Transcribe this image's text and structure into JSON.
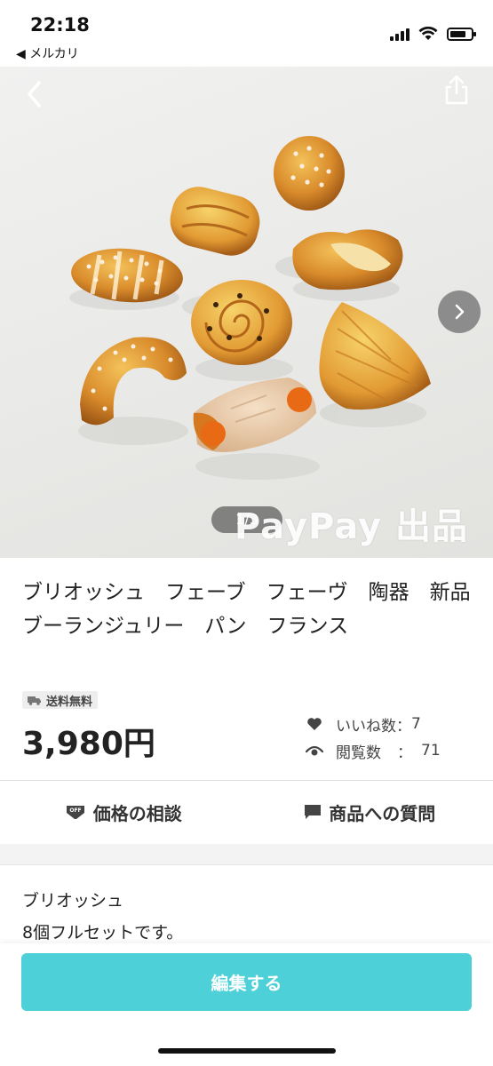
{
  "status_bar": {
    "time": "22:18",
    "back_app_label": "◀ メルカリ",
    "battery_level": 0.75,
    "icons": [
      "signal-icon",
      "wifi-icon",
      "battery-icon"
    ]
  },
  "gallery": {
    "counter": "1/3",
    "watermark": "PayPay 出品",
    "icons": [
      "back-arrow-icon",
      "share-icon",
      "chevron-right-icon"
    ]
  },
  "item": {
    "title": "ブリオッシュ　フェーブ　フェーヴ　陶器　新品　ブーランジュリー　パン　フランス",
    "shipping_badge": "送料無料",
    "price": "3,980円",
    "likes_label": "いいね数",
    "likes_value": "7",
    "views_label": "閲覧数",
    "views_value": "71"
  },
  "actions": {
    "negotiate": "価格の相談",
    "question": "商品への質問"
  },
  "description": {
    "lines": [
      "ブリオッシュ",
      "8個フルセットです。"
    ]
  },
  "bottom": {
    "edit_button": "編集する"
  },
  "colors": {
    "accent": "#4dd0d8",
    "text": "#222222",
    "badge_bg": "#eeeeee"
  }
}
